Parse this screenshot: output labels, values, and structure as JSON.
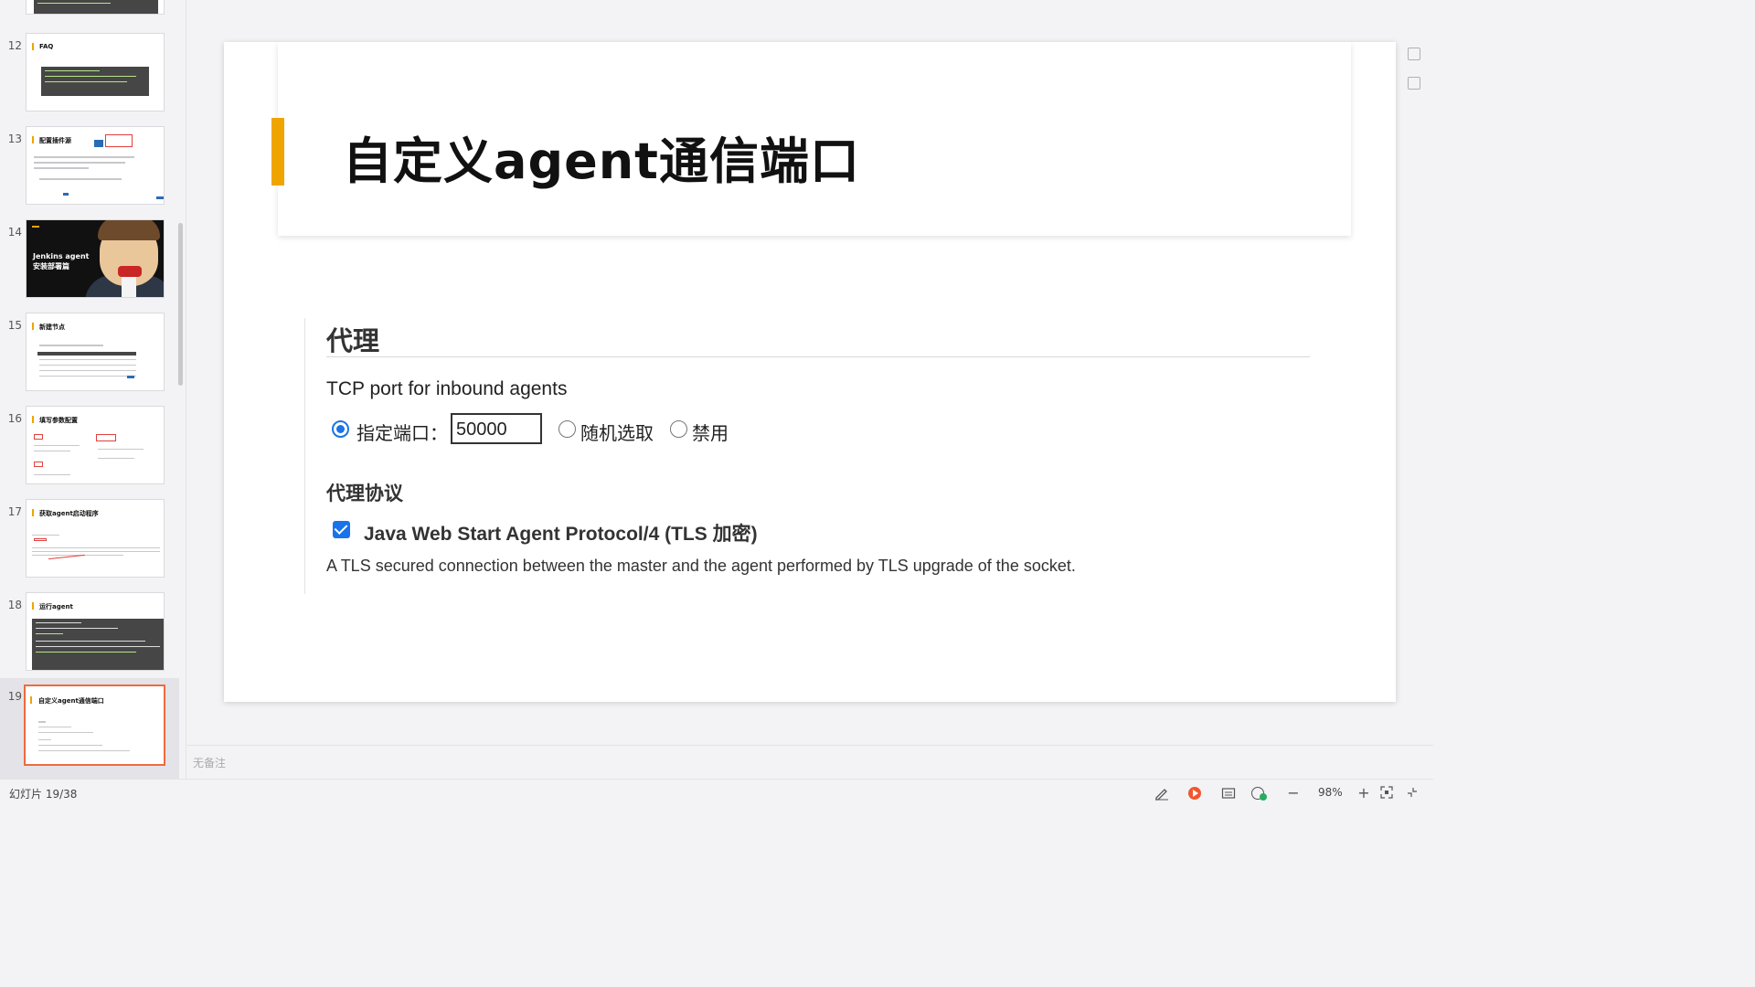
{
  "sidebar": {
    "slides": [
      {
        "num": "12",
        "title": "FAQ"
      },
      {
        "num": "13",
        "title": "配置插件源"
      },
      {
        "num": "14",
        "title": "Jenkins agent",
        "subtitle": "安装部署篇"
      },
      {
        "num": "15",
        "title": "新建节点"
      },
      {
        "num": "16",
        "title": "填写参数配置"
      },
      {
        "num": "17",
        "title": "获取agent启动程序"
      },
      {
        "num": "18",
        "title": "运行agent"
      },
      {
        "num": "19",
        "title": "自定义agent通信端口"
      }
    ]
  },
  "slide": {
    "title": "自定义agent通信端口",
    "section_heading": "代理",
    "tcp_label": "TCP port for inbound agents",
    "options": {
      "fixed_label": "指定端口：",
      "port_value": "50000",
      "random_label": "随机选取",
      "disable_label": "禁用",
      "selected": "fixed"
    },
    "protocol_heading": "代理协议",
    "protocol_label": "Java Web Start Agent Protocol/4 (TLS 加密)",
    "protocol_checked": true,
    "protocol_desc": "A TLS secured connection between the master and the agent performed by TLS upgrade of the socket."
  },
  "notes": {
    "placeholder": "无备注"
  },
  "status": {
    "counter": "幻灯片 19/38",
    "zoom": "98%"
  },
  "colors": {
    "accent": "#f0a400",
    "current_slide_border": "#ef6a3f",
    "radio_blue": "#1a73e8"
  }
}
